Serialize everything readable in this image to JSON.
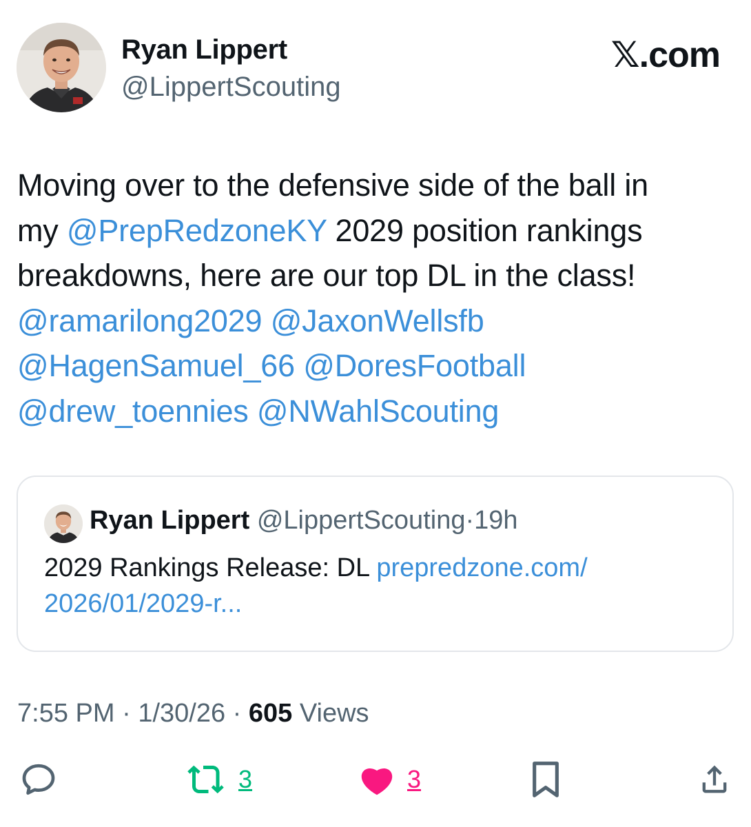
{
  "author": {
    "name": "Ryan Lippert",
    "handle": "@LippertScouting"
  },
  "brand": "𝕏.com",
  "tweet": {
    "lines": [
      [
        {
          "t": "Moving over to the defensive side of the ball in",
          "type": "text"
        }
      ],
      [
        {
          "t": "my ",
          "type": "text"
        },
        {
          "t": "@PrepRedzoneKY",
          "type": "mention"
        },
        {
          "t": " 2029 position rankings",
          "type": "text"
        }
      ],
      [
        {
          "t": "breakdowns, here are our top DL in the class!",
          "type": "text"
        }
      ],
      [
        {
          "t": "@ramarilong2029",
          "type": "mention"
        },
        {
          "t": " ",
          "type": "text"
        },
        {
          "t": "@JaxonWellsfb",
          "type": "mention"
        }
      ],
      [
        {
          "t": "@HagenSamuel_66",
          "type": "mention"
        },
        {
          "t": " ",
          "type": "text"
        },
        {
          "t": "@DoresFootball",
          "type": "mention"
        }
      ],
      [
        {
          "t": "@drew_toennies",
          "type": "mention"
        },
        {
          "t": " ",
          "type": "text"
        },
        {
          "t": "@NWahlScouting",
          "type": "mention"
        }
      ]
    ]
  },
  "quote": {
    "name": "Ryan Lippert",
    "handle": "@LippertScouting",
    "dot": "·",
    "time": "19h",
    "text_prefix": "2029 Rankings Release: DL ",
    "link_line1": "prepredzone.com/",
    "link_line2": "2026/01/2029-r..."
  },
  "meta": {
    "time": "7:55 PM",
    "sep": "·",
    "date": "1/30/26",
    "views_count": "605",
    "views_label": "Views"
  },
  "actions": {
    "reply_icon": "reply-bubble",
    "repost_count": "3",
    "like_count": "3",
    "colors": {
      "repost": "#00ba7c",
      "like": "#f91880",
      "link": "#3b8fd9",
      "secondary": "#536471"
    }
  }
}
